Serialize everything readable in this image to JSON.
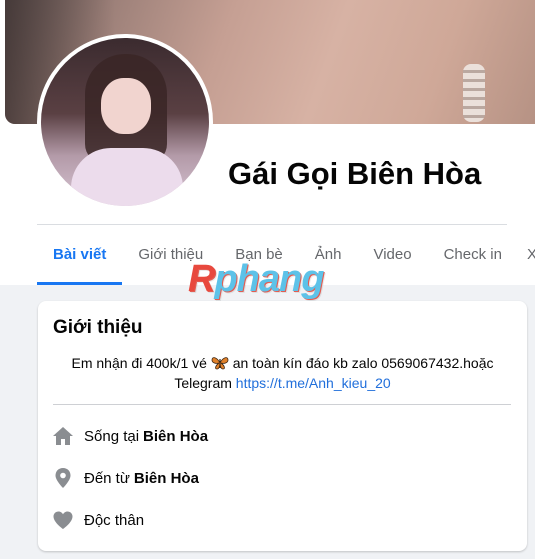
{
  "profile": {
    "name": "Gái Gọi Biên Hòa"
  },
  "tabs": [
    {
      "label": "Bài viết",
      "active": true
    },
    {
      "label": "Giới thiệu",
      "active": false
    },
    {
      "label": "Bạn bè",
      "active": false
    },
    {
      "label": "Ảnh",
      "active": false
    },
    {
      "label": "Video",
      "active": false
    },
    {
      "label": "Check in",
      "active": false
    }
  ],
  "tab_overflow": "X",
  "watermark": {
    "text": "Rphang"
  },
  "intro": {
    "title": "Giới thiệu",
    "bio_line1_before": "Em nhận đi 400k/1 vé",
    "bio_line1_after": "an toàn kín đáo kb zalo 0569067432.hoặc",
    "bio_line2_prefix": "Telegram",
    "bio_link": "https://t.me/Anh_kieu_20",
    "rows": [
      {
        "icon": "home-icon",
        "text": "Sống tại",
        "strong": "Biên Hòa"
      },
      {
        "icon": "location-pin-icon",
        "text": "Đến từ",
        "strong": "Biên Hòa"
      },
      {
        "icon": "heart-icon",
        "text": "Độc thân",
        "strong": ""
      }
    ]
  },
  "colors": {
    "accent": "#1877f2",
    "muted_text": "#65676b",
    "link": "#216fdb",
    "background": "#f0f2f5",
    "icon_gray": "#8a8d91"
  }
}
